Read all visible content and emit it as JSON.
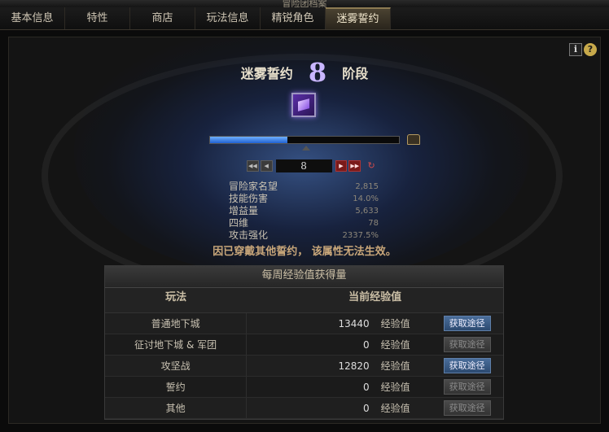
{
  "window": {
    "title": "冒险团档案"
  },
  "tabs": [
    "基本信息",
    "特性",
    "商店",
    "玩法信息",
    "精锐角色",
    "迷雾誓约"
  ],
  "active_tab_index": 5,
  "stage": {
    "label_left": "迷雾誓约",
    "number": "8",
    "label_right": "阶段"
  },
  "progress": {
    "fraction": 0.41
  },
  "stepper": {
    "first": "◀◀",
    "prev": "◀",
    "value": "8",
    "next": "▶",
    "last": "▶▶",
    "reset": "↻"
  },
  "stats": [
    {
      "name": "冒险家名望",
      "value": "2,815"
    },
    {
      "name": "技能伤害",
      "value": "14.0%"
    },
    {
      "name": "增益量",
      "value": "5,633"
    },
    {
      "name": "四维",
      "value": "78"
    },
    {
      "name": "攻击强化",
      "value": "2337.5%"
    }
  ],
  "warning": "因已穿戴其他誓约， 该属性无法生效。",
  "weekly": {
    "title": "每周经验值获得量",
    "col_mode": "玩法",
    "col_exp": "当前经验值",
    "unit": "经验值",
    "button_label": "获取途径",
    "rows": [
      {
        "mode": "普通地下城",
        "value": "13440",
        "enabled": true
      },
      {
        "mode": "征讨地下城 & 军团",
        "value": "0",
        "enabled": false
      },
      {
        "mode": "攻坚战",
        "value": "12820",
        "enabled": true
      },
      {
        "mode": "誓约",
        "value": "0",
        "enabled": false
      },
      {
        "mode": "其他",
        "value": "0",
        "enabled": false
      }
    ]
  },
  "icons": {
    "info": "i",
    "help": "?"
  },
  "colors": {
    "stage_number": "#c9b6ff",
    "button_active": "#3b5f8c",
    "warning": "#c9a77a"
  }
}
